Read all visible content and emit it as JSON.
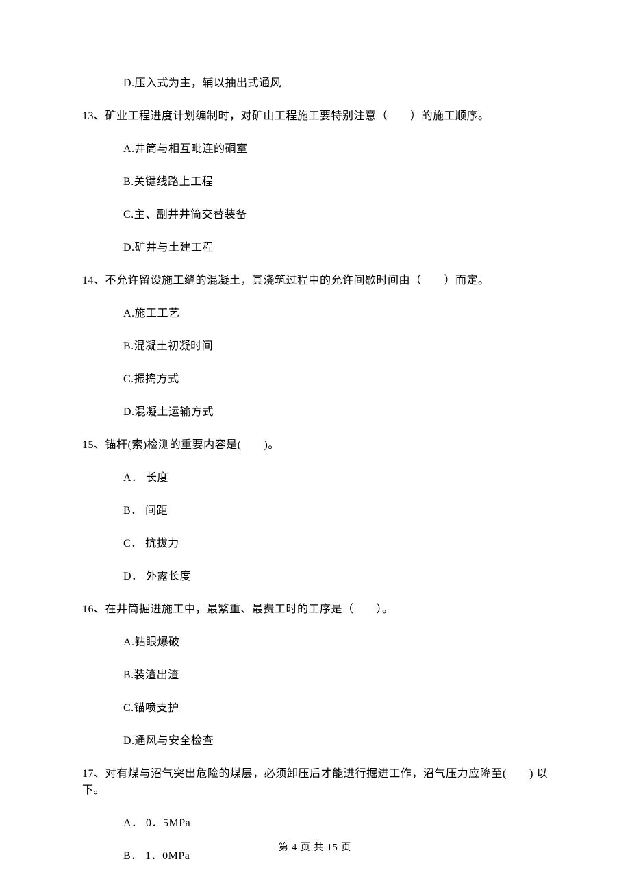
{
  "q12": {
    "options": {
      "d": "D.压入式为主，辅以抽出式通风"
    }
  },
  "q13": {
    "stem": "13、矿业工程进度计划编制时，对矿山工程施工要特别注意（　　）的施工顺序。",
    "options": {
      "a": "A.井筒与相互毗连的硐室",
      "b": "B.关键线路上工程",
      "c": "C.主、副井井筒交替装备",
      "d": "D.矿井与土建工程"
    }
  },
  "q14": {
    "stem": "14、不允许留设施工缝的混凝土，其浇筑过程中的允许间歇时间由（　　）而定。",
    "options": {
      "a": "A.施工工艺",
      "b": "B.混凝土初凝时间",
      "c": "C.振捣方式",
      "d": "D.混凝土运输方式"
    }
  },
  "q15": {
    "stem": "15、锚杆(索)检测的重要内容是(　　)。",
    "options": {
      "a": "A． 长度",
      "b": "B． 间距",
      "c": "C． 抗拔力",
      "d": "D． 外露长度"
    }
  },
  "q16": {
    "stem": "16、在井筒掘进施工中，最繁重、最费工时的工序是（　　）。",
    "options": {
      "a": "A.钻眼爆破",
      "b": "B.装渣出渣",
      "c": "C.锚喷支护",
      "d": "D.通风与安全检查"
    }
  },
  "q17": {
    "stem": "17、对有煤与沼气突出危险的煤层，必须卸压后才能进行掘进工作，沼气压力应降至(　　) 以下。",
    "options": {
      "a": "A． 0．5MPa",
      "b": "B． 1．0MPa"
    }
  },
  "footer": "第 4 页 共 15 页"
}
